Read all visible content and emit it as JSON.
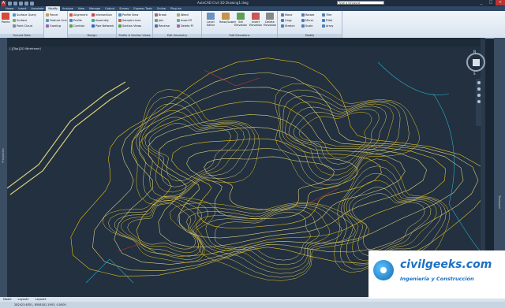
{
  "window": {
    "app_button": "A",
    "title": "AutoCAD Civil 3D  Drawing1.dwg",
    "search_placeholder": "Type a keyword",
    "controls": [
      "_",
      "□",
      "×"
    ]
  },
  "ribbon_tabs": [
    "Home",
    "Insert",
    "Annotate",
    "Modify",
    "Analyze",
    "View",
    "Manage",
    "Output",
    "Survey",
    "Express Tools",
    "Online",
    "Plug-ins"
  ],
  "ribbon_active_tab": "Modify",
  "ribbon": {
    "panel1": {
      "title": "Ground Data",
      "big": "Points",
      "items": [
        "Surface Query",
        "Surface",
        "Point Cloud",
        "Parcel",
        "Feature Line",
        "Grading"
      ]
    },
    "panel2": {
      "title": "Design",
      "items": [
        "Alignment",
        "Profile",
        "Corridor",
        "Intersection",
        "Assembly",
        "Pipe Network"
      ]
    },
    "panel3": {
      "title": "Profile & Section Views",
      "items": [
        "Profile View",
        "Sample Lines",
        "Section Views"
      ]
    },
    "panel4": {
      "title": "Edit Geometry",
      "items": [
        "Break",
        "Join",
        "Reverse",
        "Weed",
        "Insert PI",
        "Delete PI"
      ]
    },
    "panel5": {
      "title": "Edit Elevations",
      "items": [
        "Level Editor",
        "Raise/Lower",
        "Set Elevation",
        "Insert Elevation",
        "Delete Elevation"
      ]
    },
    "panel6": {
      "title": "Modify",
      "items": [
        "Move",
        "Copy",
        "Stretch",
        "Rotate",
        "Mirror",
        "Scale",
        "Trim",
        "Fillet",
        "Array"
      ]
    }
  },
  "viewport": {
    "label": "[-][Top][2D Wireframe]",
    "compass": {
      "n": "N",
      "s": "S",
      "e": "E",
      "w": "W"
    },
    "viewcube_face": "TOP"
  },
  "palettes": {
    "left": "Prospector",
    "right": "Toolspace"
  },
  "layout_tabs": [
    "Model",
    "Layout1",
    "Layout2"
  ],
  "status": {
    "coordinates": "282423.6351, 8558181.1953, 0.0000"
  },
  "watermark": {
    "name": "civilgeeks.com",
    "tagline": "Ingeniería y Construcción"
  },
  "colors": {
    "background": "#22303f",
    "contour_major": "#e8c21f",
    "contour_minor": "#dccf7a",
    "contour_extra": "#2bb0c9",
    "red_lines": "#c8343a"
  }
}
